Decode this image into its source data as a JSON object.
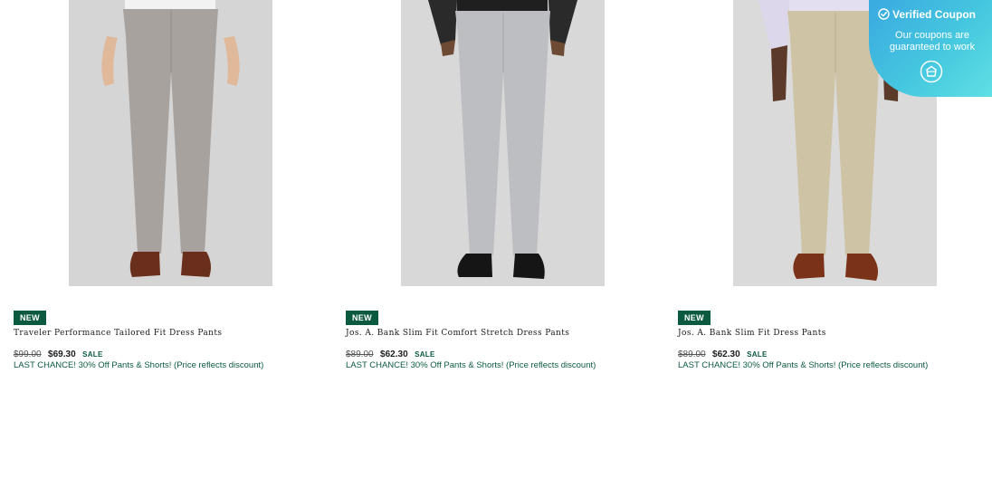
{
  "products": [
    {
      "badge": "NEW",
      "name": "Traveler Performance Tailored Fit Dress Pants",
      "original_price": "$99.00",
      "sale_price": "$69.30",
      "sale_label": "SALE",
      "promo": "LAST CHANCE! 30% Off Pants & Shorts! (Price reflects discount)",
      "pant_color": "#a7a29d",
      "shoe_color": "#6a2f1c"
    },
    {
      "badge": "NEW",
      "name": "Jos. A. Bank Slim Fit Comfort Stretch Dress Pants",
      "original_price": "$89.00",
      "sale_price": "$62.30",
      "sale_label": "SALE",
      "promo": "LAST CHANCE! 30% Off Pants & Shorts! (Price reflects discount)",
      "pant_color": "#bcbec1",
      "shoe_color": "#151515"
    },
    {
      "badge": "NEW",
      "name": "Jos. A. Bank Slim Fit Dress Pants",
      "original_price": "$89.00",
      "sale_price": "$62.30",
      "sale_label": "SALE",
      "promo": "LAST CHANCE! 30% Off Pants & Shorts! (Price reflects discount)",
      "pant_color": "#cfc3a6",
      "shoe_color": "#7a3318"
    }
  ],
  "coupon": {
    "title": "Verified Coupon",
    "subtitle": "Our coupons are guaranteed to work",
    "check_icon": "check-circle-icon",
    "action_icon": "coupon-tag-icon"
  }
}
